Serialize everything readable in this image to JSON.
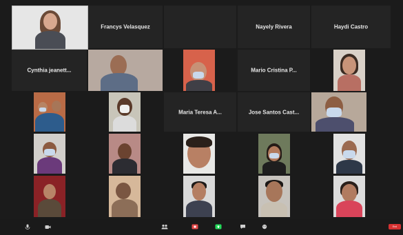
{
  "meeting": {
    "participants_named": [
      {
        "id": "p-francys",
        "name": "Francys Velasquez"
      },
      {
        "id": "p-nayely",
        "name": "Nayely Rivera"
      },
      {
        "id": "p-haydi",
        "name": "Haydi Castro"
      },
      {
        "id": "p-cynthia",
        "name": "Cynthia  jeanett..."
      },
      {
        "id": "p-mario",
        "name": "Mario Cristina P..."
      },
      {
        "id": "p-maria-teresa",
        "name": "Maria Teresa A..."
      },
      {
        "id": "p-jose",
        "name": "Jose Santos Cast..."
      }
    ]
  },
  "toolbar": {
    "end_label": "End"
  },
  "colors": {
    "background": "#1b1b1b",
    "tile": "#242424",
    "end_button": "#d63232",
    "active_share": "#23d959",
    "record_red": "#e34a4a"
  }
}
